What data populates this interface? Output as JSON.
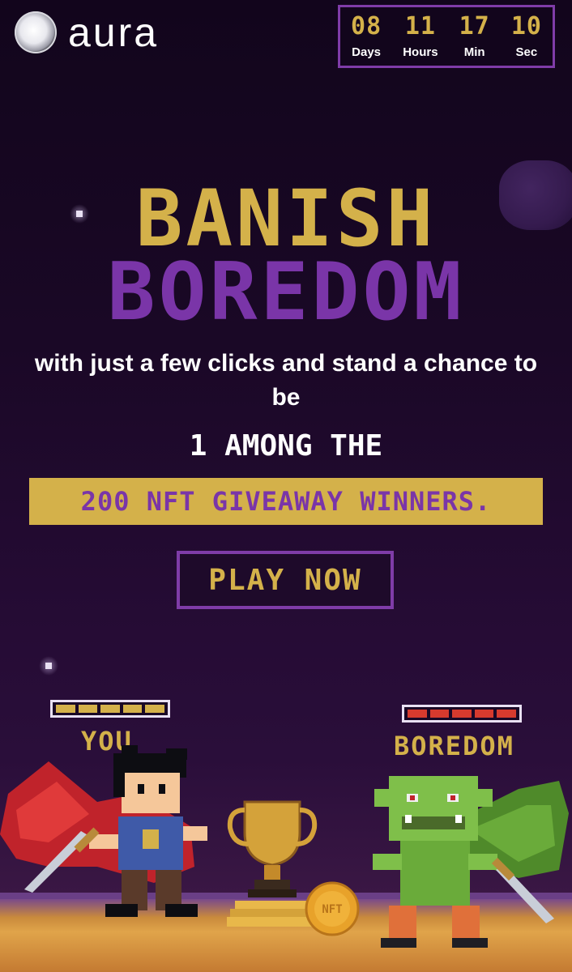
{
  "brand": {
    "name": "aura"
  },
  "countdown": [
    {
      "value": "08",
      "label": "Days"
    },
    {
      "value": "11",
      "label": "Hours"
    },
    {
      "value": "17",
      "label": "Min"
    },
    {
      "value": "10",
      "label": "Sec"
    }
  ],
  "hero": {
    "title_line1": "BANISH",
    "title_line2": "BOREDOM",
    "subtitle": "with just a few clicks and stand a chance to be",
    "among": "1 AMONG THE",
    "banner": "200 NFT GIVEAWAY WINNERS.",
    "cta": "PLAY NOW"
  },
  "battle": {
    "player": {
      "name": "YOU",
      "health": 1.0,
      "health_color": "#d4b14a"
    },
    "enemy": {
      "name": "BOREDOM",
      "health": 1.0,
      "health_color": "#d63a2e"
    },
    "coin_label": "NFT"
  },
  "colors": {
    "gold": "#d4b14a",
    "purple": "#7a35a8",
    "border": "#7f3ca8",
    "bg": "#1a0826"
  }
}
